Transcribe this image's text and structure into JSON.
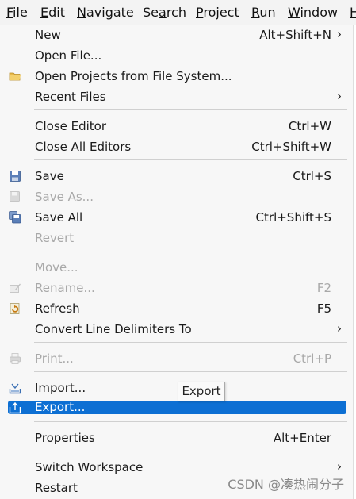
{
  "menubar": {
    "file": {
      "key": "F",
      "rest": "ile"
    },
    "edit": {
      "key": "E",
      "rest": "dit"
    },
    "navigate": {
      "key": "N",
      "rest": "avigate"
    },
    "search": {
      "key": "a",
      "pre": "Se",
      "rest": "rch"
    },
    "project": {
      "key": "P",
      "rest": "roject"
    },
    "run": {
      "key": "R",
      "rest": "un"
    },
    "window": {
      "key": "W",
      "rest": "indow"
    },
    "help": {
      "key": "H",
      "rest": "elp"
    }
  },
  "menu": {
    "new": {
      "label": "New",
      "accel": "Alt+Shift+N",
      "arrow": "›"
    },
    "open_file": {
      "label": "Open File..."
    },
    "open_projects": {
      "label": "Open Projects from File System..."
    },
    "recent_files": {
      "label": "Recent Files",
      "arrow": "›"
    },
    "close_editor": {
      "label": "Close Editor",
      "accel": "Ctrl+W"
    },
    "close_all_editors": {
      "label": "Close All Editors",
      "accel": "Ctrl+Shift+W"
    },
    "save": {
      "label": "Save",
      "accel": "Ctrl+S"
    },
    "save_as": {
      "label": "Save As..."
    },
    "save_all": {
      "label": "Save All",
      "accel": "Ctrl+Shift+S"
    },
    "revert": {
      "label": "Revert"
    },
    "move": {
      "label": "Move..."
    },
    "rename": {
      "label": "Rename...",
      "accel": "F2"
    },
    "refresh": {
      "label": "Refresh",
      "accel": "F5"
    },
    "convert_line_delimiters": {
      "label": "Convert Line Delimiters To",
      "arrow": "›"
    },
    "print": {
      "label": "Print...",
      "accel": "Ctrl+P"
    },
    "import": {
      "label": "Import..."
    },
    "export": {
      "label": "Export..."
    },
    "properties": {
      "label": "Properties",
      "accel": "Alt+Enter"
    },
    "switch_workspace": {
      "label": "Switch Workspace",
      "arrow": "›"
    },
    "restart": {
      "label": "Restart"
    }
  },
  "tooltip": {
    "text": "Export"
  },
  "watermark": {
    "text": "CSDN @凑热闹分子"
  },
  "colors": {
    "highlight": "#0d6fd3",
    "menu_bg": "#f7f7f7",
    "disabled": "#a9a9a9"
  }
}
